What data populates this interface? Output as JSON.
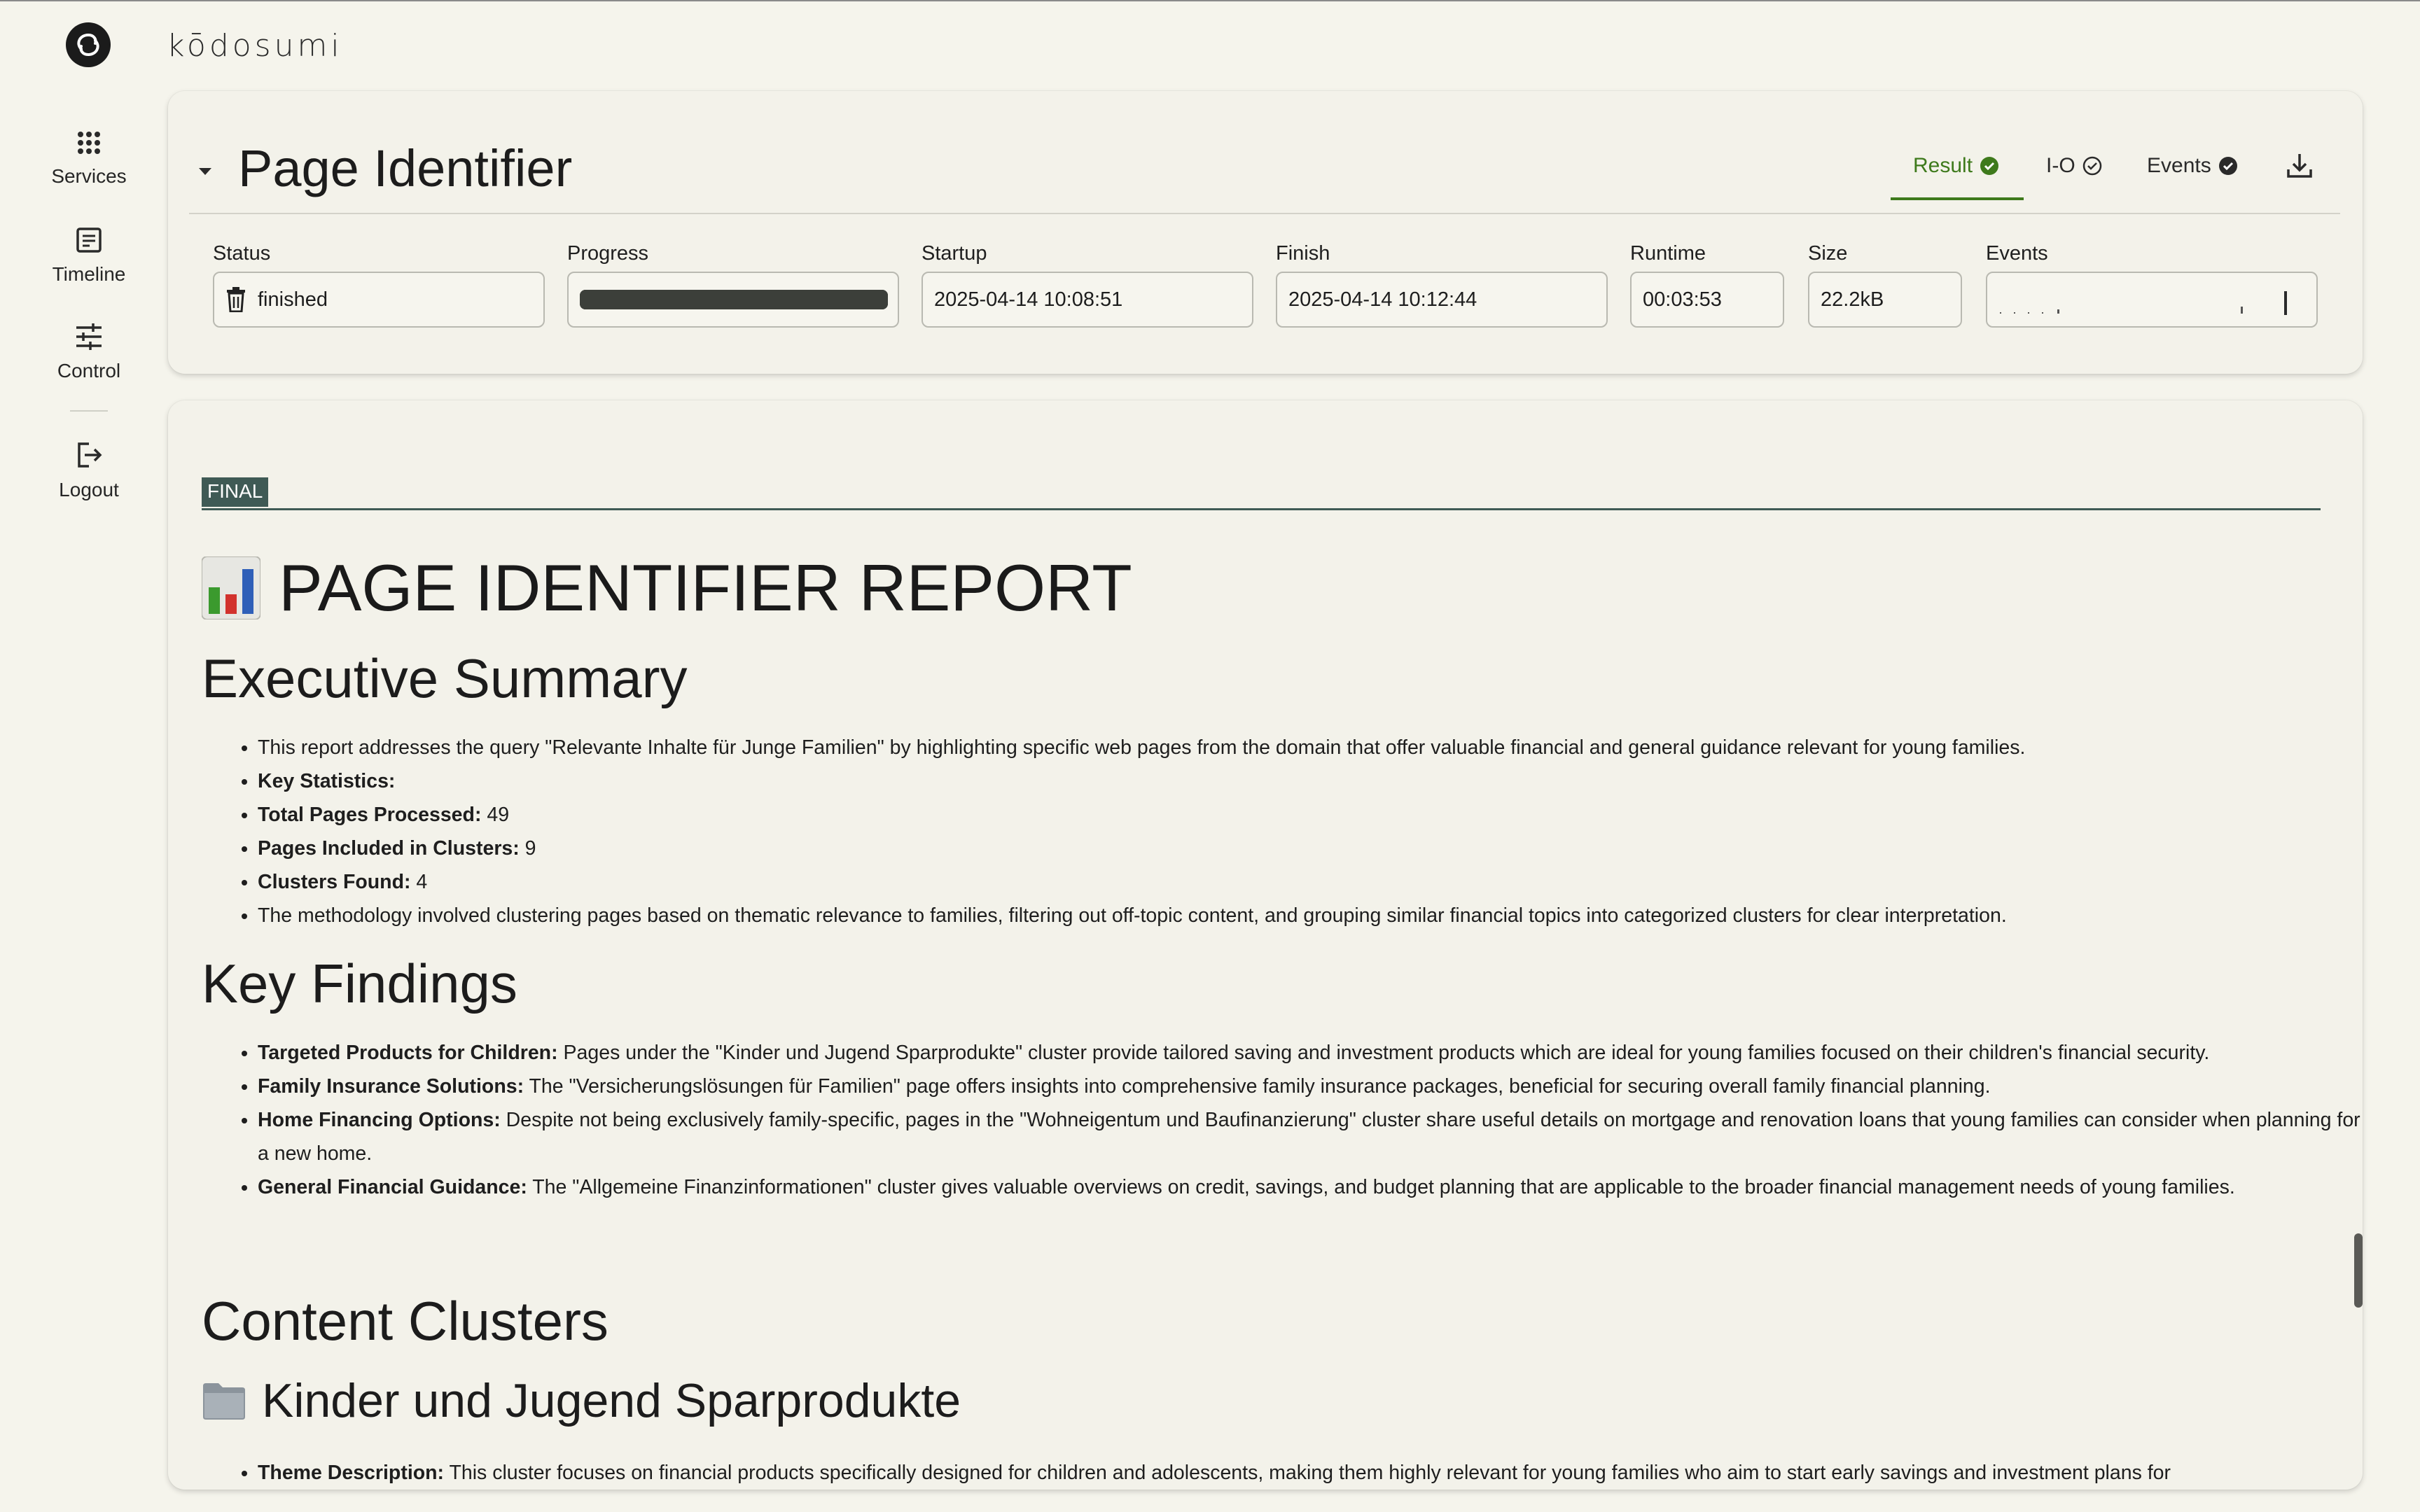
{
  "app": {
    "brand": "kōdosumi",
    "colors": {
      "accent": "#3e7a1c",
      "final_tag": "#3f5a55",
      "background": "#f5f4ec"
    }
  },
  "sidebar": {
    "items": [
      {
        "label": "Services",
        "icon": "grid-dots-icon"
      },
      {
        "label": "Timeline",
        "icon": "document-list-icon"
      },
      {
        "label": "Control",
        "icon": "sliders-icon"
      },
      {
        "label": "Logout",
        "icon": "logout-icon"
      }
    ]
  },
  "header": {
    "title": "Page Identifier",
    "tabs": [
      {
        "label": "Result",
        "icon": "check-circle-filled-icon",
        "active": true
      },
      {
        "label": "I-O",
        "icon": "check-circle-outline-icon",
        "active": false
      },
      {
        "label": "Events",
        "icon": "check-circle-filled-icon",
        "active": false
      }
    ],
    "download_icon": "download-icon"
  },
  "fields": {
    "status": {
      "label": "Status",
      "value": "finished",
      "icon": "trash-icon"
    },
    "progress": {
      "label": "Progress",
      "percent": 100
    },
    "startup": {
      "label": "Startup",
      "value": "2025-04-14 10:08:51"
    },
    "finish": {
      "label": "Finish",
      "value": "2025-04-14 10:12:44"
    },
    "runtime": {
      "label": "Runtime",
      "value": "00:03:53"
    },
    "size": {
      "label": "Size",
      "value": "22.2kB"
    },
    "events": {
      "label": "Events"
    }
  },
  "report": {
    "tag": "FINAL",
    "title_icon": "bar-chart-emoji-icon",
    "title": "PAGE IDENTIFIER REPORT",
    "executive_summary": {
      "heading": "Executive Summary",
      "items": [
        {
          "bold": "",
          "text": "This report addresses the query \"Relevante Inhalte für Junge Familien\" by highlighting specific web pages from the domain that offer valuable financial and general guidance relevant for young families."
        },
        {
          "bold": "Key Statistics:",
          "text": ""
        },
        {
          "bold": "Total Pages Processed:",
          "text": " 49"
        },
        {
          "bold": "Pages Included in Clusters:",
          "text": " 9"
        },
        {
          "bold": "Clusters Found:",
          "text": " 4"
        },
        {
          "bold": "",
          "text": "The methodology involved clustering pages based on thematic relevance to families, filtering out off-topic content, and grouping similar financial topics into categorized clusters for clear interpretation."
        }
      ]
    },
    "key_findings": {
      "heading": "Key Findings",
      "items": [
        {
          "bold": "Targeted Products for Children:",
          "text": " Pages under the \"Kinder und Jugend Sparprodukte\" cluster provide tailored saving and investment products which are ideal for young families focused on their children's financial security."
        },
        {
          "bold": "Family Insurance Solutions:",
          "text": " The \"Versicherungslösungen für Familien\" page offers insights into comprehensive family insurance packages, beneficial for securing overall family financial planning."
        },
        {
          "bold": "Home Financing Options:",
          "text": " Despite not being exclusively family-specific, pages in the \"Wohneigentum und Baufinanzierung\" cluster share useful details on mortgage and renovation loans that young families can consider when planning for a new home."
        },
        {
          "bold": "General Financial Guidance:",
          "text": " The \"Allgemeine Finanzinformationen\" cluster gives valuable overviews on credit, savings, and budget planning that are applicable to the broader financial management needs of young families."
        }
      ]
    },
    "content_clusters": {
      "heading": "Content Clusters",
      "cluster": {
        "icon": "folder-emoji-icon",
        "title": "Kinder und Jugend Sparprodukte",
        "items": [
          {
            "bold": "Theme Description:",
            "text": " This cluster focuses on financial products specifically designed for children and adolescents, making them highly relevant for young families who aim to start early savings and investment plans for"
          }
        ]
      }
    }
  }
}
